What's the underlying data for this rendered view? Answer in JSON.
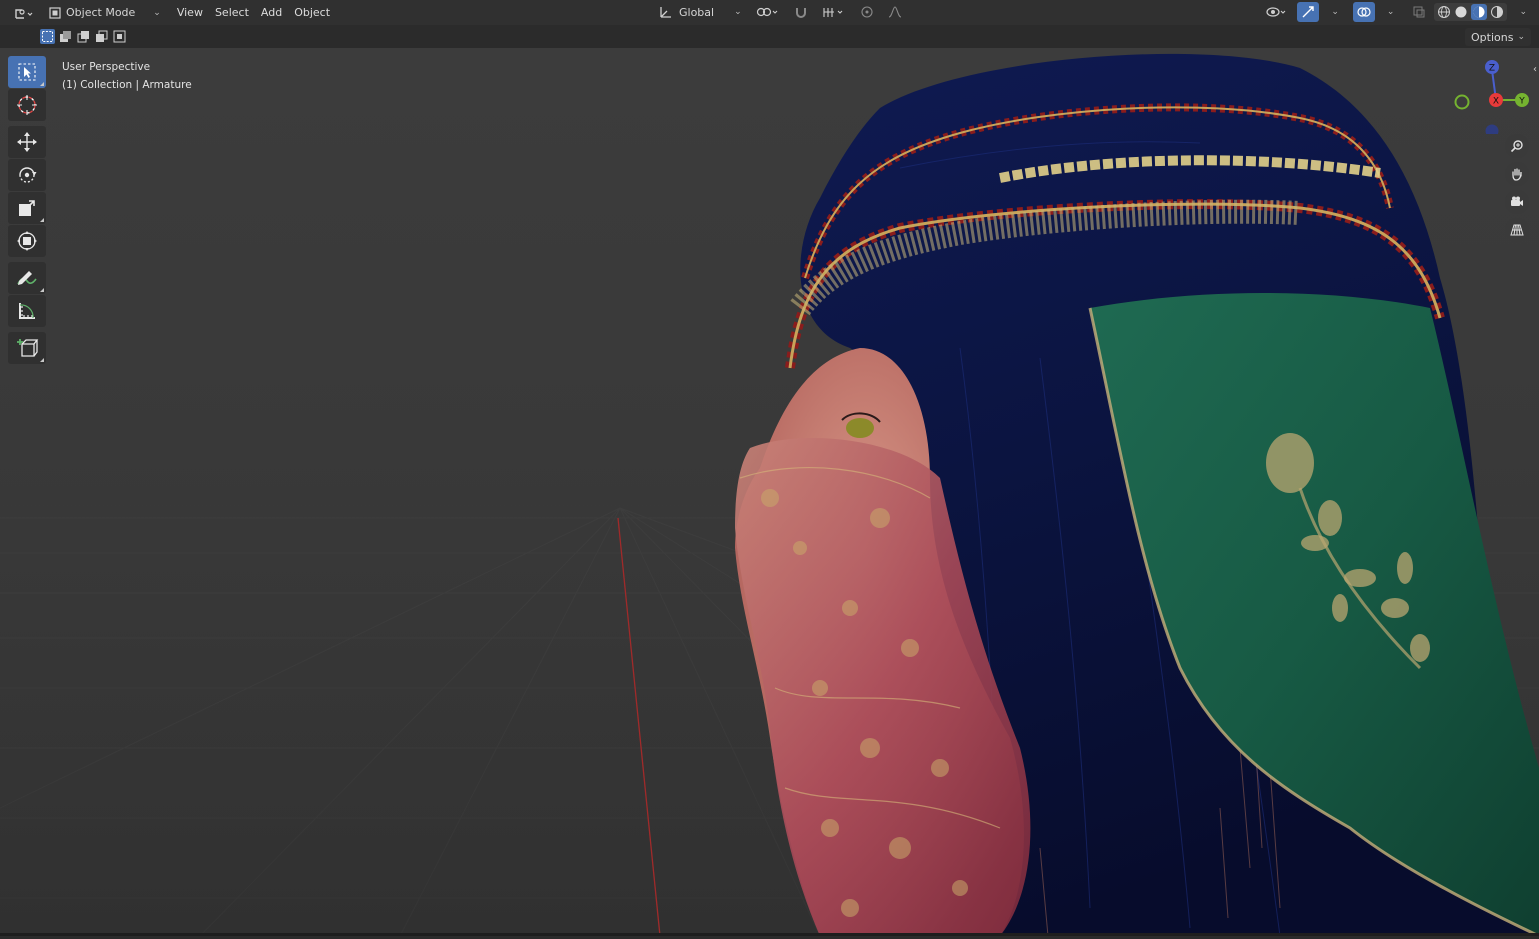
{
  "header": {
    "mode": "Object Mode",
    "menus": [
      "View",
      "Select",
      "Add",
      "Object"
    ],
    "transform_orientation": "Global"
  },
  "subheader": {
    "options_label": "Options"
  },
  "viewport": {
    "view_name": "User Perspective",
    "collection_info": "(1) Collection | Armature"
  },
  "gizmo": {
    "axes": [
      "X",
      "Y",
      "Z"
    ],
    "colors": {
      "x": "#e83a3a",
      "y": "#75b330",
      "z": "#4a5fcd",
      "nz": "#2e3d87"
    }
  },
  "toolbar": {
    "tools": [
      "select-box-tool",
      "cursor-tool",
      "move-tool",
      "rotate-tool",
      "scale-tool",
      "transform-tool",
      "annotate-tool",
      "measure-tool",
      "add-cube-tool"
    ]
  },
  "colors": {
    "accent": "#4772b3",
    "header_bg": "#303030",
    "viewport_bg": "#393939"
  }
}
